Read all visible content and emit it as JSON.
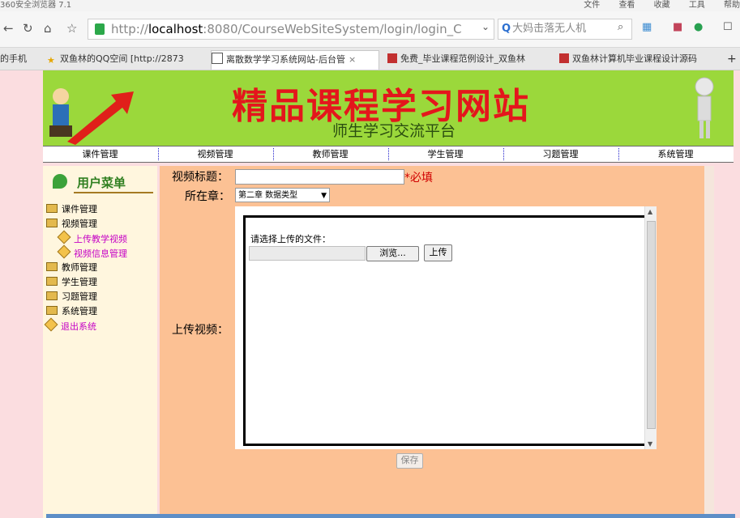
{
  "browser": {
    "title": "360安全浏览器 7.1",
    "menu": [
      "文件",
      "查看",
      "收藏",
      "工具",
      "帮助"
    ],
    "address": {
      "prefix": "http://",
      "host": "localhost",
      "rest": ":8080/CourseWebSiteSystem/login/login_C"
    },
    "search_text": "大妈击落无人机",
    "tabs": [
      {
        "label": "的手机"
      },
      {
        "label": "双鱼林的QQ空间 [http://2873"
      },
      {
        "label": "离散数学学习系统网站-后台管"
      },
      {
        "label": "免费_毕业课程范例设计_双鱼林"
      },
      {
        "label": "双鱼林计算机毕业课程设计源码"
      }
    ]
  },
  "banner": {
    "title": "精品课程学习网站",
    "subtitle": "师生学习交流平台"
  },
  "nav": [
    "课件管理",
    "视频管理",
    "教师管理",
    "学生管理",
    "习题管理",
    "系统管理"
  ],
  "sidebar": {
    "heading": "用户菜单",
    "items": [
      {
        "label": "课件管理"
      },
      {
        "label": "视频管理"
      },
      {
        "label": "上传教学视频"
      },
      {
        "label": "视频信息管理"
      },
      {
        "label": "教师管理"
      },
      {
        "label": "学生管理"
      },
      {
        "label": "习题管理"
      },
      {
        "label": "系统管理"
      },
      {
        "label": "退出系统"
      }
    ]
  },
  "form": {
    "title_label": "视频标题：",
    "title_value": "",
    "required": "*必填",
    "chapter_label": "所在章：",
    "chapter_value": "第二章  数据类型",
    "upload_label": "上传视频：",
    "choose_file": "请选择上传的文件：",
    "browse": "浏览...",
    "upload": "上传",
    "save": "保存"
  }
}
